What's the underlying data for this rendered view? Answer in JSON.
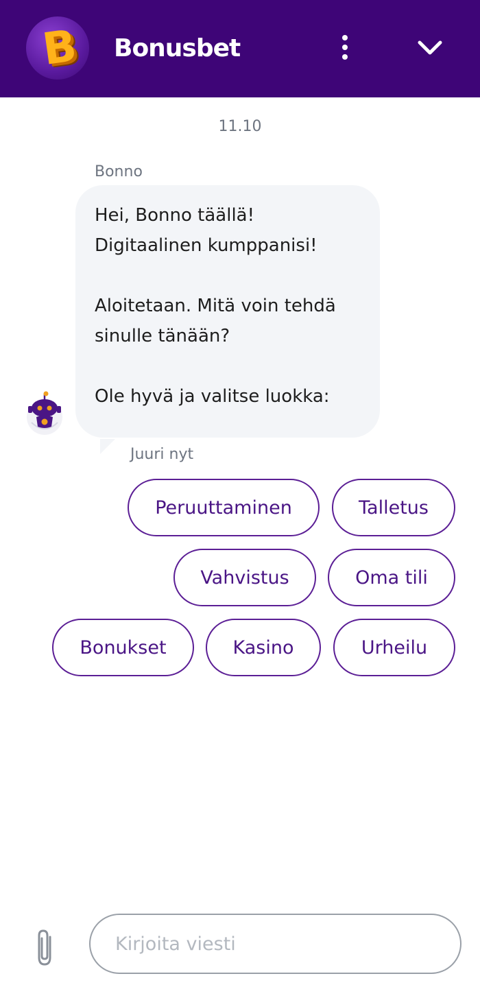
{
  "header": {
    "logo_letter": "B",
    "title": "Bonusbet"
  },
  "chat": {
    "date": "11.10",
    "sender": "Bonno",
    "message": "Hei, Bonno täällä!\nDigitaalinen kumppanisi!\n\nAloitetaan. Mitä voin tehdä sinulle tänään?\n\nOle hyvä ja valitse luokka:",
    "time": "Juuri nyt"
  },
  "quick_replies": [
    "Peruuttaminen",
    "Talletus",
    "Vahvistus",
    "Oma tili",
    "Bonukset",
    "Kasino",
    "Urheilu"
  ],
  "composer": {
    "placeholder": "Kirjoita viesti"
  },
  "colors": {
    "header_bg": "#3e0577",
    "accent": "#5b1e95",
    "bubble_bg": "#f3f5f8"
  },
  "icons": {
    "menu": "vertical-dots-icon",
    "collapse": "chevron-down-icon",
    "attach": "paperclip-icon",
    "avatar": "robot-icon"
  }
}
